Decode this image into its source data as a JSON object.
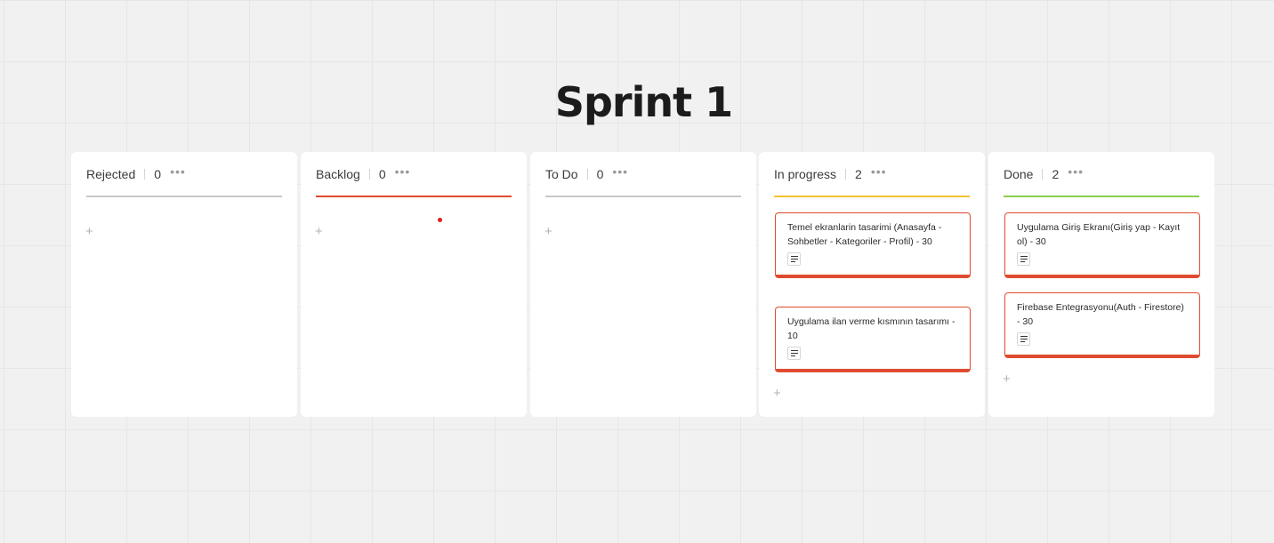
{
  "board": {
    "title": "Sprint 1"
  },
  "colors": {
    "background": "#f1f1f1",
    "card_border": "#e04b2f",
    "rejected_line": "#c8c8c8",
    "backlog_line": "#e04b2f",
    "todo_line": "#c8c8c8",
    "inprogress_line": "#f2c230",
    "done_line": "#8ccf4d"
  },
  "columns": [
    {
      "name": "Rejected",
      "count": "0",
      "more_label": "•••",
      "add_label": "+",
      "cards": []
    },
    {
      "name": "Backlog",
      "count": "0",
      "more_label": "•••",
      "add_label": "+",
      "cards": []
    },
    {
      "name": "To Do",
      "count": "0",
      "more_label": "•••",
      "add_label": "+",
      "cards": []
    },
    {
      "name": "In progress",
      "count": "2",
      "more_label": "•••",
      "add_label": "+",
      "cards": [
        {
          "text": "Temel ekranlarin tasarimi (Anasayfa - Sohbetler - Kategoriler - Profil) - 30",
          "icon": "description-icon"
        },
        {
          "text": "Uygulama ilan verme kısmının tasarımı - 10",
          "icon": "description-icon"
        }
      ]
    },
    {
      "name": "Done",
      "count": "2",
      "more_label": "•••",
      "add_label": "+",
      "cards": [
        {
          "text": "Uygulama Giriş Ekranı(Giriş yap - Kayıt ol) - 30",
          "icon": "description-icon"
        },
        {
          "text": "Firebase Entegrasyonu(Auth - Firestore) - 30",
          "icon": "description-icon"
        }
      ]
    }
  ]
}
